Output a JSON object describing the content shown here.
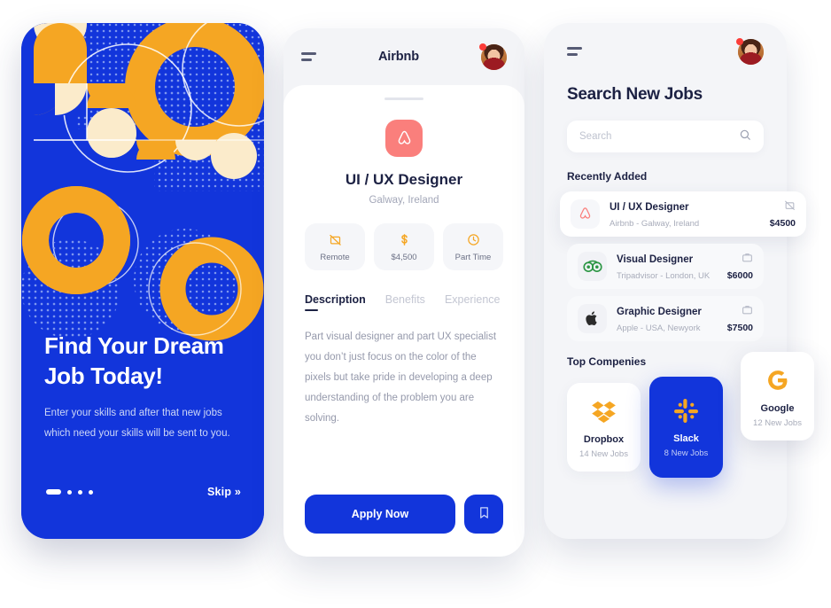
{
  "colors": {
    "blue": "#1235DB",
    "orange": "#F5A623",
    "cream": "#FBEBCB",
    "coral": "#FA7F7C",
    "dark": "#1C2143"
  },
  "onboarding": {
    "title_line1": "Find Your Dream",
    "title_line2": "Job Today!",
    "subtitle_line1": "Enter your skills and after that new jobs",
    "subtitle_line2": "which need your skills will be sent to you.",
    "skip_label": "Skip »",
    "dots_total": 4,
    "dots_active_index": 0
  },
  "detail": {
    "header_title": "Airbnb",
    "menu_icon": "hamburger-icon",
    "avatar_icon": "user-avatar",
    "company_logo_icon": "airbnb-logo",
    "job_title": "UI / UX Designer",
    "job_location": "Galway, Ireland",
    "chips": [
      {
        "icon": "no-office-icon",
        "label": "Remote"
      },
      {
        "icon": "dollar-icon",
        "label": "$4,500"
      },
      {
        "icon": "clock-icon",
        "label": "Part Time"
      }
    ],
    "tabs": [
      {
        "label": "Description",
        "active": true
      },
      {
        "label": "Benefits",
        "active": false
      },
      {
        "label": "Experience",
        "active": false
      }
    ],
    "description": "Part visual designer and part UX specialist you don’t just focus on the color of the pixels but take pride in developing a deep understanding of the problem you are solving.",
    "apply_label": "Apply Now",
    "bookmark_icon": "bookmark-icon"
  },
  "search": {
    "menu_icon": "hamburger-icon",
    "avatar_icon": "user-avatar",
    "page_title": "Search New Jobs",
    "search_value": "",
    "search_placeholder": "Search",
    "search_icon": "search-icon",
    "recent_heading": "Recently Added",
    "jobs": [
      {
        "logo": "airbnb-logo",
        "title": "UI / UX Designer",
        "meta": "Airbnb - Galway, Ireland",
        "pay": "$4500",
        "badge": "no-office-icon",
        "featured": true
      },
      {
        "logo": "tripadvisor-logo",
        "title": "Visual Designer",
        "meta": "Tripadvisor - London, UK",
        "pay": "$6000",
        "badge": "briefcase-icon",
        "featured": false
      },
      {
        "logo": "apple-logo",
        "title": "Graphic Designer",
        "meta": "Apple - USA, Newyork",
        "pay": "$7500",
        "badge": "briefcase-icon",
        "featured": false
      }
    ],
    "companies_heading": "Top Compenies",
    "companies": [
      {
        "logo": "dropbox-logo",
        "name": "Dropbox",
        "jobs": "14 New Jobs",
        "active": false
      },
      {
        "logo": "slack-logo",
        "name": "Slack",
        "jobs": "8 New Jobs",
        "active": true
      },
      {
        "logo": "google-logo",
        "name": "Google",
        "jobs": "12 New Jobs",
        "active": false
      }
    ]
  }
}
